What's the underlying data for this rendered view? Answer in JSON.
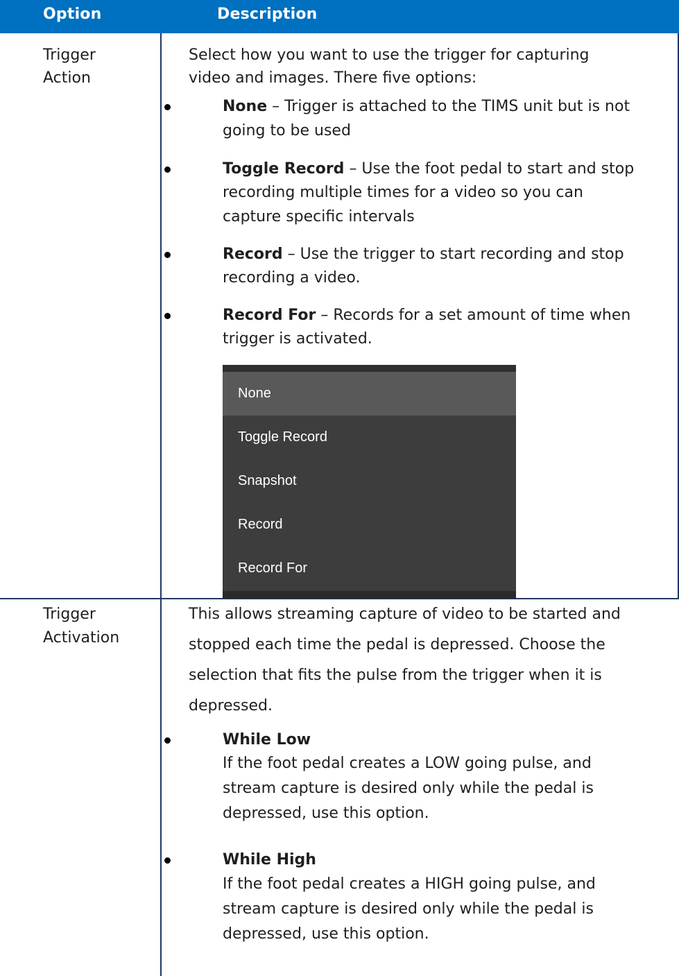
{
  "header": {
    "option": "Option",
    "description": "Description"
  },
  "rows": [
    {
      "option_line1": "Trigger",
      "option_line2": "Action",
      "intro_line1": "Select how you want to use the trigger for capturing",
      "intro_line2": "video and images. There five options:",
      "bullets": [
        {
          "term": "None",
          "lines": [
            "– Trigger is attached to the TIMS unit but is not",
            "going to be used"
          ]
        },
        {
          "term": "Toggle Record",
          "lines": [
            "– Use the foot pedal to start and stop",
            "recording multiple times for a video so you can",
            "capture specific intervals"
          ]
        },
        {
          "term": "Record",
          "lines": [
            "– Use the trigger to start recording and stop",
            "recording a video."
          ]
        },
        {
          "term": "Record For",
          "lines": [
            "– Records for a set amount of time when",
            "trigger is activated."
          ]
        }
      ],
      "menu": {
        "selected": "None",
        "items": [
          "None",
          "Toggle Record",
          "Snapshot",
          "Record",
          "Record For"
        ]
      }
    },
    {
      "option_line1": "Trigger",
      "option_line2": "Activation",
      "intro_lines": [
        "This allows streaming capture of video to be started and",
        "stopped each time the pedal is depressed. Choose the",
        "selection that fits the pulse from the trigger when it is",
        "depressed."
      ],
      "bullets": [
        {
          "term": "While Low",
          "lines": [
            "If the foot pedal creates a LOW going pulse, and",
            "stream capture is desired only while the pedal is",
            "depressed, use this option."
          ]
        },
        {
          "term": "While High",
          "lines": [
            "If the foot pedal creates a HIGH going pulse, and",
            "stream capture is desired only while the pedal is",
            "depressed, use this option."
          ]
        }
      ]
    }
  ]
}
